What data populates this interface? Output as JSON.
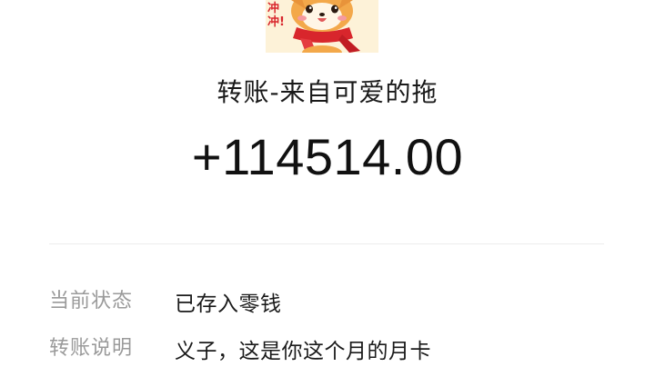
{
  "avatar": {
    "icon": "shiba-dog-sticker-icon",
    "sticker_text": "冲冲!"
  },
  "transfer": {
    "title": "转账-来自可爱的拖",
    "amount": "+114514.00"
  },
  "details": [
    {
      "label": "当前状态",
      "value": "已存入零钱"
    },
    {
      "label": "转账说明",
      "value": "义子，这是你这个月的月卡"
    }
  ],
  "colors": {
    "text_primary": "#1a1a1a",
    "text_secondary": "#9a9a9a",
    "divider": "#ececec",
    "sticker_bg": "#fdf2d8",
    "scarf_red": "#d8262c"
  }
}
